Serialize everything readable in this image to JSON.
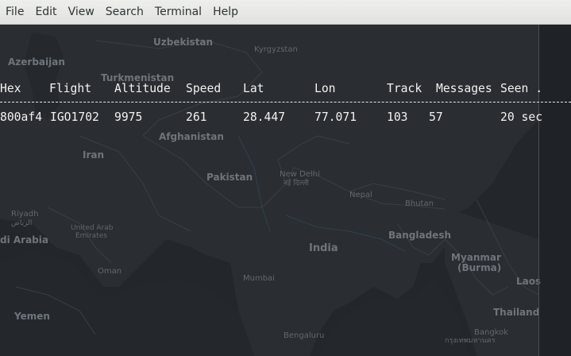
{
  "menubar": {
    "items": [
      {
        "label": "File"
      },
      {
        "label": "Edit"
      },
      {
        "label": "View"
      },
      {
        "label": "Search"
      },
      {
        "label": "Terminal"
      },
      {
        "label": "Help"
      }
    ]
  },
  "table": {
    "headers": {
      "hex": "Hex",
      "flight": "Flight",
      "altitude": "Altitude",
      "speed": "Speed",
      "lat": "Lat",
      "lon": "Lon",
      "track": "Track",
      "messages": "Messages",
      "seen": "Seen ."
    },
    "rows": [
      {
        "hex": "800af4",
        "flight": "IGO1702",
        "altitude": "9975",
        "speed": "261",
        "lat": "28.447",
        "lon": "77.071",
        "track": "103",
        "messages": "57",
        "seen": "20 sec"
      }
    ]
  },
  "map_background": {
    "labels": {
      "uzbekistan": "Uzbekistan",
      "kyrgyzstan": "Kyrgyzstan",
      "azerbaijan": "Azerbaijan",
      "turkmenistan": "Turkmenistan",
      "afghanistan": "Afghanistan",
      "iran": "Iran",
      "pakistan": "Pakistan",
      "new_delhi": "New Delhi",
      "new_delhi_hindi": "नई दिल्ली",
      "nepal": "Nepal",
      "bhutan": "Bhutan",
      "riyadh": "Riyadh",
      "riyadh_arabic": "الرياض",
      "saudi_arabia": "di Arabia",
      "uae_line1": "United Arab",
      "uae_line2": "Emirates",
      "oman": "Oman",
      "bangladesh": "Bangladesh",
      "india": "India",
      "myanmar": "Myanmar",
      "burma": "(Burma)",
      "mumbai": "Mumbai",
      "laos": "Laos",
      "yemen": "Yemen",
      "thailand": "Thailand",
      "bengaluru": "Bengaluru",
      "bangkok": "Bangkok",
      "bangkok_thai": "กรุงเทพมหานคร"
    }
  }
}
